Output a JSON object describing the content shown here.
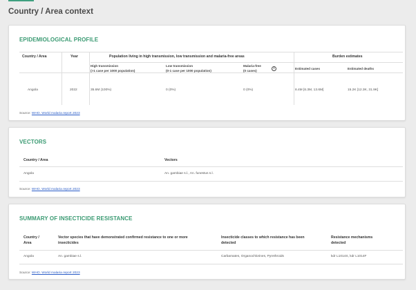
{
  "page": {
    "title": "Country / Area context"
  },
  "epi": {
    "title": "EPIDEMIOLOGICAL PROFILE",
    "headers": {
      "country": "Country / Area",
      "year": "Year",
      "population": "Population living in high transmission, low transmission and malaria-free areas",
      "burden": "Burden estimates"
    },
    "subheaders": {
      "high_1": "High transmission",
      "high_2": "(>1 case per 1000 population)",
      "low_1": "Low transmission",
      "low_2": "(0-1 case per 1000 population)",
      "free_1": "Malaria-free",
      "free_2": "(0 cases)",
      "cases": "Estimated cases",
      "deaths": "Estimated deaths"
    },
    "row": {
      "country": "Angola",
      "year": "2022",
      "high": "35.6M (100%)",
      "low": "0 (0%)",
      "free": "0 (0%)",
      "cases": "8.4M [6.3M, 13.6M]",
      "deaths": "15.2K [12.3K, 31.9K]"
    },
    "source_label": "Source:",
    "source_link": "WHO. World malaria report 2023"
  },
  "vectors": {
    "title": "VECTORS",
    "headers": {
      "country": "Country / Area",
      "vectors": "Vectors"
    },
    "row": {
      "country": "Angola",
      "vectors": "An. gambiae s.l., An. funestus s.l."
    },
    "source_label": "Source:",
    "source_link": "WHO. World malaria report 2023"
  },
  "resistance": {
    "title": "SUMMARY OF INSECTICIDE RESISTANCE",
    "headers": {
      "country_1": "Country /",
      "country_2": "Area",
      "species_1": "Vector species that have demonstrated confirmed resistance to one or more",
      "species_2": "insecticides",
      "classes_1": "Insecticide classes to which resistance has been",
      "classes_2": "detected",
      "mech_1": "Resistance mechanisms",
      "mech_2": "detected"
    },
    "row": {
      "country": "Angola",
      "species": "An. gambiae s.l.",
      "classes": "Carbamates, Organochlorines, Pyrethroids",
      "mechanisms": "kdr L1014S, kdr L1014F"
    },
    "source_label": "Source:",
    "source_link": "WHO. World malaria report 2023"
  },
  "icons": {
    "info": "info-icon"
  }
}
